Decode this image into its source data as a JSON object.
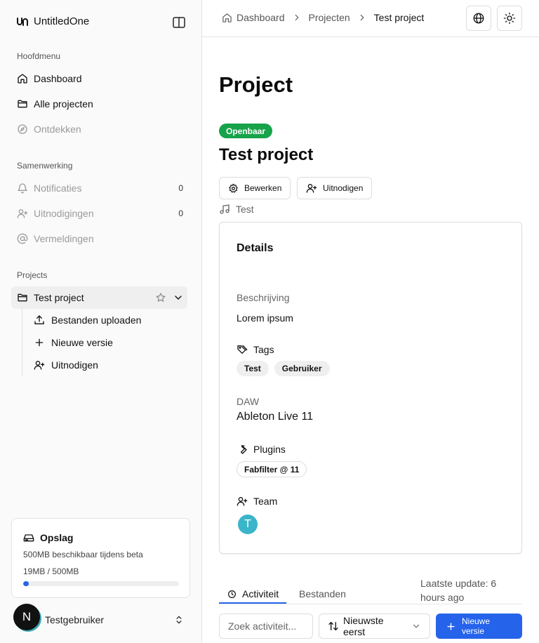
{
  "app": {
    "name": "UntitledOne"
  },
  "sidebar": {
    "main_label": "Hoofdmenu",
    "main_items": [
      {
        "label": "Dashboard",
        "icon": "home-icon"
      },
      {
        "label": "Alle projecten",
        "icon": "folder-icon"
      },
      {
        "label": "Ontdekken",
        "icon": "compass-icon"
      }
    ],
    "collab_label": "Samenwerking",
    "collab_items": [
      {
        "label": "Notificaties",
        "count": "0",
        "icon": "bell-icon"
      },
      {
        "label": "Uitnodigingen",
        "count": "0",
        "icon": "user-plus-icon"
      },
      {
        "label": "Vermeldingen",
        "icon": "at-sign-icon"
      }
    ],
    "projects_label": "Projects",
    "project": {
      "label": "Test project"
    },
    "project_subitems": [
      {
        "label": "Bestanden uploaden",
        "icon": "upload-icon"
      },
      {
        "label": "Nieuwe versie",
        "icon": "plus-icon"
      },
      {
        "label": "Uitnodigen",
        "icon": "user-plus-icon"
      }
    ],
    "storage": {
      "title": "Opslag",
      "description": "500MB beschikbaar tijdens beta",
      "usage": "19MB / 500MB",
      "used_fraction": 0.038,
      "accent": "#2563eb"
    },
    "user": {
      "initial": "N",
      "name": "Testgebruiker"
    }
  },
  "header": {
    "breadcrumbs": [
      "Dashboard",
      "Projecten",
      "Test project"
    ]
  },
  "main": {
    "title": "Project",
    "visibility_badge": "Openbaar",
    "badge_color": "#16a34a",
    "project_name": "Test project",
    "edit_label": "Bewerken",
    "invite_label": "Uitnodigen",
    "genre": "Test",
    "details": {
      "title": "Details",
      "description_label": "Beschrijving",
      "description": "Lorem ipsum",
      "tags_label": "Tags",
      "tags": [
        "Test",
        "Gebruiker"
      ],
      "daw_label": "DAW",
      "daw": "Ableton Live 11",
      "plugins_label": "Plugins",
      "plugins": [
        "Fabfilter @ 11"
      ],
      "team_label": "Team",
      "team": [
        "T"
      ]
    },
    "tabs": [
      {
        "label": "Activiteit",
        "active": true
      },
      {
        "label": "Bestanden",
        "active": false
      }
    ],
    "last_update": "Laatste update: 6 hours ago",
    "search_placeholder": "Zoek activiteit...",
    "sort_label": "Nieuwste eerst",
    "new_version_label": "Nieuwe versie"
  }
}
